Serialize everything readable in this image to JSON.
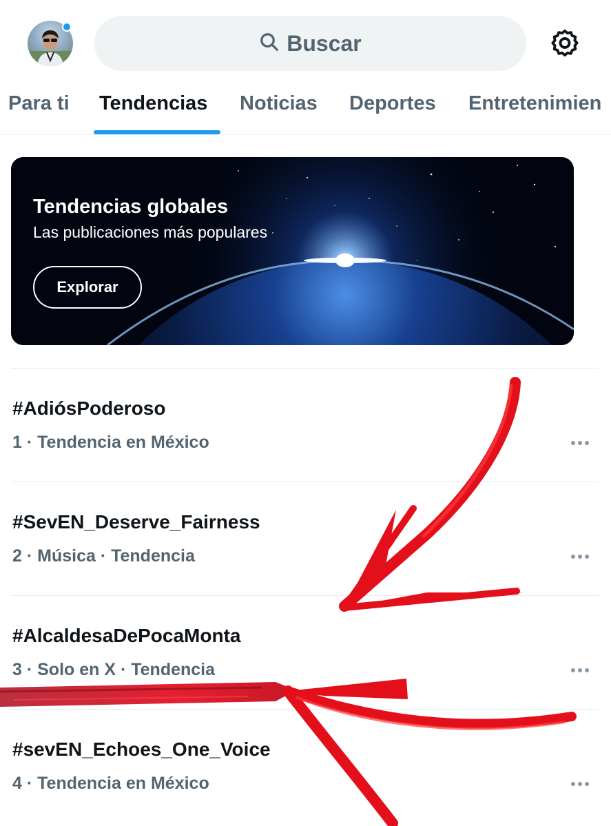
{
  "header": {
    "search_label": "Buscar"
  },
  "tabs": [
    {
      "label": "Para ti"
    },
    {
      "label": "Tendencias"
    },
    {
      "label": "Noticias"
    },
    {
      "label": "Deportes"
    },
    {
      "label": "Entretenimien"
    }
  ],
  "banner": {
    "title": "Tendencias globales",
    "subtitle": "Las publicaciones más populares",
    "button_label": "Explorar"
  },
  "trends": [
    {
      "title": "#AdiósPoderoso",
      "meta": "1 · Tendencia en México"
    },
    {
      "title": "#SevEN_Deserve_Fairness",
      "meta": "2 · Música · Tendencia"
    },
    {
      "title": "#AlcaldesaDePocaMonta",
      "meta": "3 · Solo en X · Tendencia"
    },
    {
      "title": "#sevEN_Echoes_One_Voice",
      "meta": "4 · Tendencia en México"
    }
  ],
  "colors": {
    "accent": "#1d9bf0",
    "annotation": "#e3101b"
  }
}
